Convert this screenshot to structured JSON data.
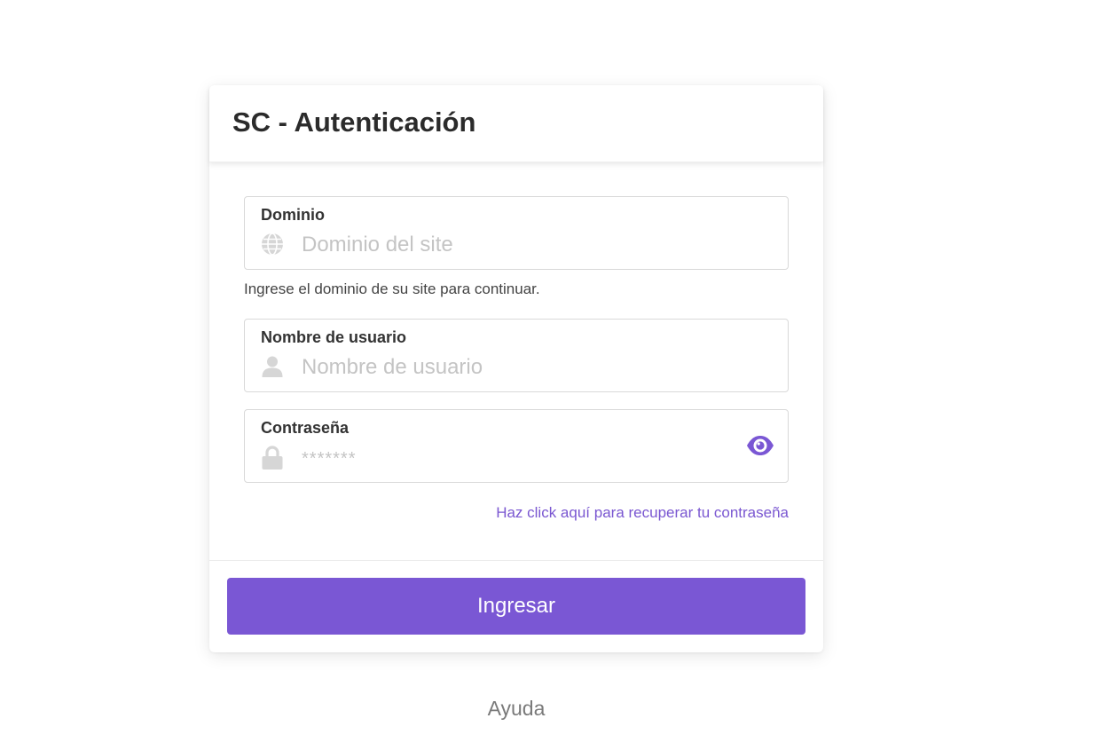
{
  "card": {
    "title": "SC - Autenticación"
  },
  "domain_field": {
    "label": "Dominio",
    "icon": "globe-icon",
    "value": "",
    "placeholder": "Dominio del site",
    "help": "Ingrese el dominio de su site para continuar."
  },
  "username_field": {
    "label": "Nombre de usuario",
    "icon": "user-icon",
    "value": "",
    "placeholder": "Nombre de usuario"
  },
  "password_field": {
    "label": "Contraseña",
    "icon": "lock-icon",
    "value": "",
    "placeholder": "*******",
    "toggle_icon": "eye-icon"
  },
  "recover_link": "Haz click aquí para recuperar tu contraseña",
  "submit_label": "Ingresar",
  "footer": {
    "help_link": "Ayuda"
  },
  "colors": {
    "accent": "#7a57d4",
    "icon_gray": "#d6d6d6",
    "placeholder": "#c4c4c4"
  }
}
